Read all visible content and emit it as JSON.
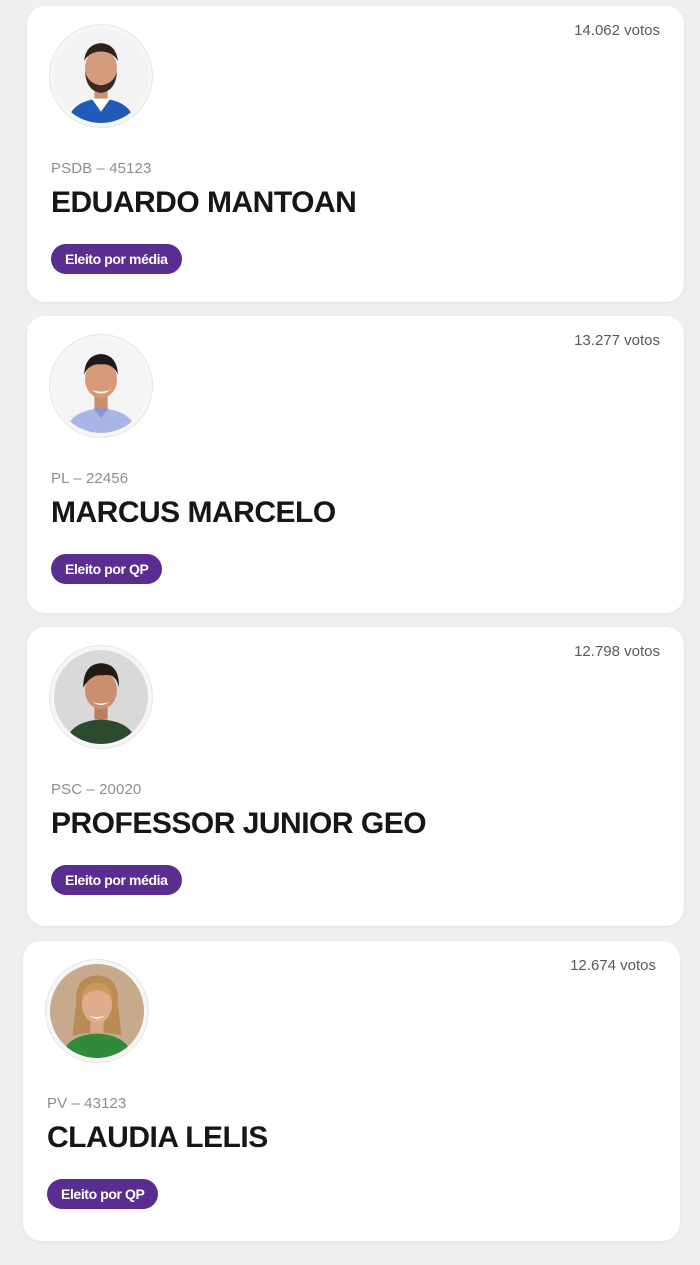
{
  "candidates": [
    {
      "votes": "14.062 votos",
      "party": "PSDB – 45123",
      "name": "EDUARDO MANTOAN",
      "status": "Eleito por média",
      "photo": "man-beard-portrait"
    },
    {
      "votes": "13.277 votos",
      "party": "PL – 22456",
      "name": "MARCUS MARCELO",
      "status": "Eleito por QP",
      "photo": "man-smiling-portrait"
    },
    {
      "votes": "12.798 votos",
      "party": "PSC – 20020",
      "name": "PROFESSOR JUNIOR GEO",
      "status": "Eleito por média",
      "photo": "man-dark-hair-portrait"
    },
    {
      "votes": "12.674 votos",
      "party": "PV – 43123",
      "name": "CLAUDIA LELIS",
      "status": "Eleito por QP",
      "photo": "woman-blonde-portrait"
    }
  ],
  "colors": {
    "badge": "#5a2d91",
    "page_background": "#efefef",
    "card": "#ffffff"
  }
}
